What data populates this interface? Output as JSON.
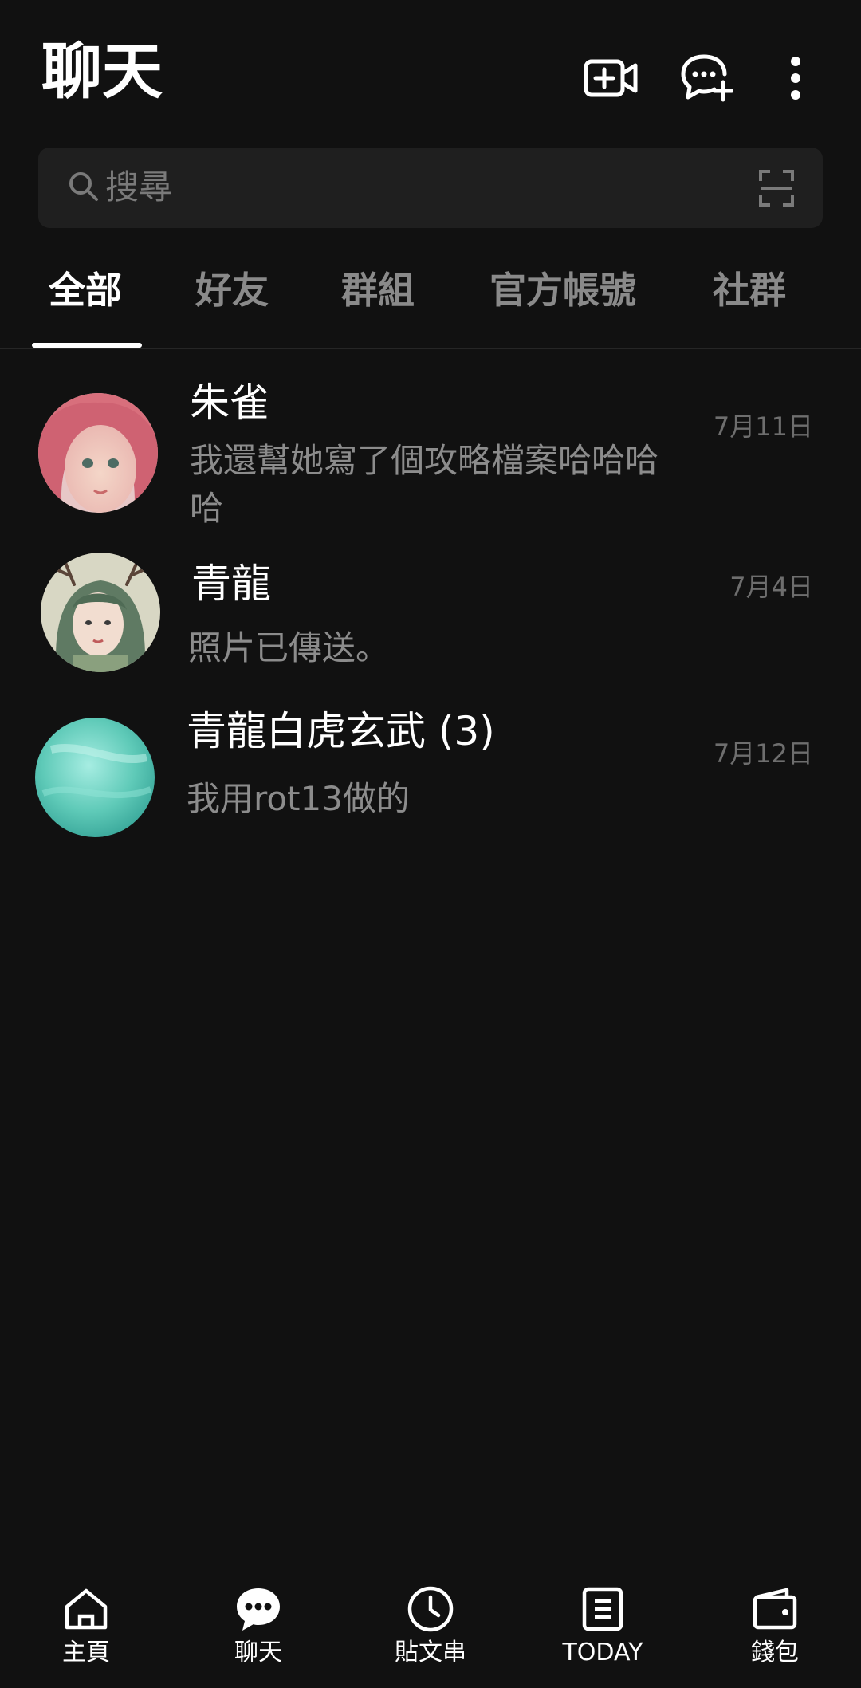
{
  "header": {
    "title": "聊天",
    "icons": [
      "video-call-add-icon",
      "new-chat-icon",
      "more-vertical-icon"
    ]
  },
  "search": {
    "placeholder": "搜尋",
    "icons": [
      "search-icon",
      "scan-icon"
    ]
  },
  "tabs": [
    {
      "label": "全部",
      "active": true
    },
    {
      "label": "好友",
      "active": false
    },
    {
      "label": "群組",
      "active": false
    },
    {
      "label": "官方帳號",
      "active": false
    },
    {
      "label": "社群",
      "active": false
    }
  ],
  "chats": [
    {
      "name": "朱雀",
      "message": "我還幫她寫了個攻略檔案哈哈哈哈",
      "date": "7月11日",
      "avatar": "avatar-pink-hair"
    },
    {
      "name": "青龍",
      "message": "照片已傳送。",
      "date": "7月4日",
      "avatar": "avatar-green-hair-antlers"
    },
    {
      "name": "青龍白虎玄武 (3)",
      "message": "我用rot13做的",
      "date": "7月12日",
      "avatar": "avatar-teal-gradient"
    }
  ],
  "bottom_nav": [
    {
      "label": "主頁",
      "icon": "home-icon"
    },
    {
      "label": "聊天",
      "icon": "chat-bubble-icon",
      "active": true
    },
    {
      "label": "貼文串",
      "icon": "clock-icon"
    },
    {
      "label": "TODAY",
      "icon": "news-icon"
    },
    {
      "label": "錢包",
      "icon": "wallet-icon"
    }
  ],
  "colors": {
    "background": "#111111",
    "search_bg": "#1f1f1f",
    "text_primary": "#ffffff",
    "text_secondary": "#8c8c8c",
    "tab_inactive": "#8a8a8a"
  }
}
